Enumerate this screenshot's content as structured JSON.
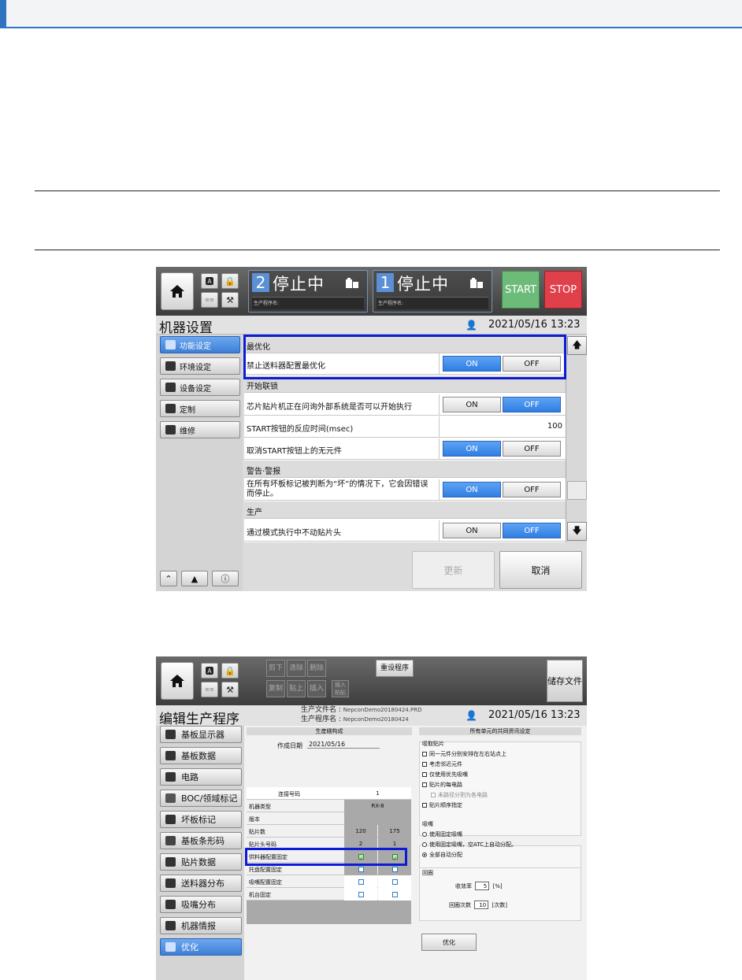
{
  "screen1": {
    "topbar": {
      "mini_icons": [
        "a-icon",
        "lock-icon",
        "config-icon",
        "tool-icon"
      ],
      "lane2": {
        "number": "2",
        "status": "停止中",
        "program_label": "生产程序名:"
      },
      "lane1": {
        "number": "1",
        "status": "停止中",
        "program_label": "生产程序名:"
      },
      "start_label": "START",
      "stop_label": "STOP",
      "colors": {
        "start": "#6dbb79",
        "stop": "#e0404a",
        "lane_number": "#5b8fd6"
      }
    },
    "title": "机器设置",
    "datetime": "2021/05/16 13:23",
    "sidebar": [
      {
        "label": "功能设定",
        "active": true
      },
      {
        "label": "环境设定",
        "active": false
      },
      {
        "label": "设备设定",
        "active": false
      },
      {
        "label": "定制",
        "active": false
      },
      {
        "label": "维修",
        "active": false
      }
    ],
    "sections": {
      "optimize": "最优化",
      "interlock": "开始联锁",
      "warning": "警告·警报",
      "production": "生产"
    },
    "rows": {
      "disable_feeder_opt": {
        "label": "禁止送料器配置最优化",
        "selected": "ON"
      },
      "chip_mounter_ask": {
        "label": "芯片贴片机正在问询外部系统是否可以开始执行",
        "selected": "OFF"
      },
      "start_response": {
        "label": "START按钮的反应时间(msec)",
        "value": "100"
      },
      "cancel_start_nocomp": {
        "label": "取消START按钮上的无元件",
        "selected": "ON"
      },
      "bad_mark_stop": {
        "label": "在所有坏板标记被判断为“坏”的情况下，它会因错误而停止。",
        "selected": "ON"
      },
      "pass_mode_nohead": {
        "label": "通过模式执行中不动贴片头",
        "selected": "OFF"
      }
    },
    "toggle": {
      "on": "ON",
      "off": "OFF"
    },
    "buttons": {
      "update": "更新",
      "cancel": "取消"
    },
    "accent_color": "#3d7fd6",
    "highlight_color": "#0b1bd6"
  },
  "screen2": {
    "toolbar": {
      "cut": "剪下",
      "clear": "清除",
      "delete": "删除",
      "copy": "复制",
      "paste": "贴上",
      "insert": "插入",
      "insert_paste": "插入粘贴",
      "reset_program": "重设程序",
      "save_file": "储存文件"
    },
    "title": "编辑生产程序",
    "file_label": "生产文件名",
    "file_name": "NepconDemo20180424.PRD",
    "program_label": "生产程序名",
    "program_name": "NepconDemo20180424",
    "datetime": "2021/05/16 13:23",
    "sidebar": [
      {
        "label": "基板显示器",
        "active": false
      },
      {
        "label": "基板数据",
        "active": false
      },
      {
        "label": "电路",
        "active": false
      },
      {
        "label": "BOC/领域标记",
        "active": false
      },
      {
        "label": "坏板标记",
        "active": false
      },
      {
        "label": "基板条形码",
        "active": false
      },
      {
        "label": "贴片数据",
        "active": false
      },
      {
        "label": "送料器分布",
        "active": false
      },
      {
        "label": "吸嘴分布",
        "active": false
      },
      {
        "label": "机器情报",
        "active": false
      },
      {
        "label": "优化",
        "active": true
      }
    ],
    "left_panel": {
      "header": "生産綫构成",
      "date_label": "作成日期",
      "date_value": "2021/05/16",
      "table": {
        "header_label": "连接号码",
        "header_value": "1",
        "machine_type": "机器类型",
        "machine_value": "RX-8",
        "version": "版本",
        "chip_count": "贴片数",
        "chip_values": [
          "120",
          "175"
        ],
        "head_no": "贴片头号码",
        "head_values": [
          "2",
          "1"
        ],
        "feeder_fix": "供料器配置固定",
        "tray_fix": "托盘配置固定",
        "nozzle_fix": "吸嘴配置固定",
        "machine_fix": "机台固定"
      }
    },
    "right_panel": {
      "header": "所有单元的共同资讯设定",
      "pickup": {
        "title": "吸取贴片",
        "opt1": "同一元件分别安排在左右站点上",
        "opt2": "考虑邻近元件",
        "opt3": "仅使用优先吸嘴",
        "opt4": "贴片的每电路",
        "opt4_sub": "未路径分割为各电路",
        "opt5": "贴片顺序指定"
      },
      "nozzle": {
        "title": "吸嘴",
        "opt1": "使用固定吸嘴",
        "opt2": "使用固定吸嘴，空ATC上自动分配。",
        "opt3": "全部自动分配"
      },
      "loop": {
        "title": "回圈",
        "rate_label": "收敛率",
        "rate_value": "5",
        "rate_unit": "[%]",
        "count_label": "回圈次数",
        "count_value": "10",
        "count_unit": "[次数]"
      },
      "optimize_button": "优化"
    }
  }
}
